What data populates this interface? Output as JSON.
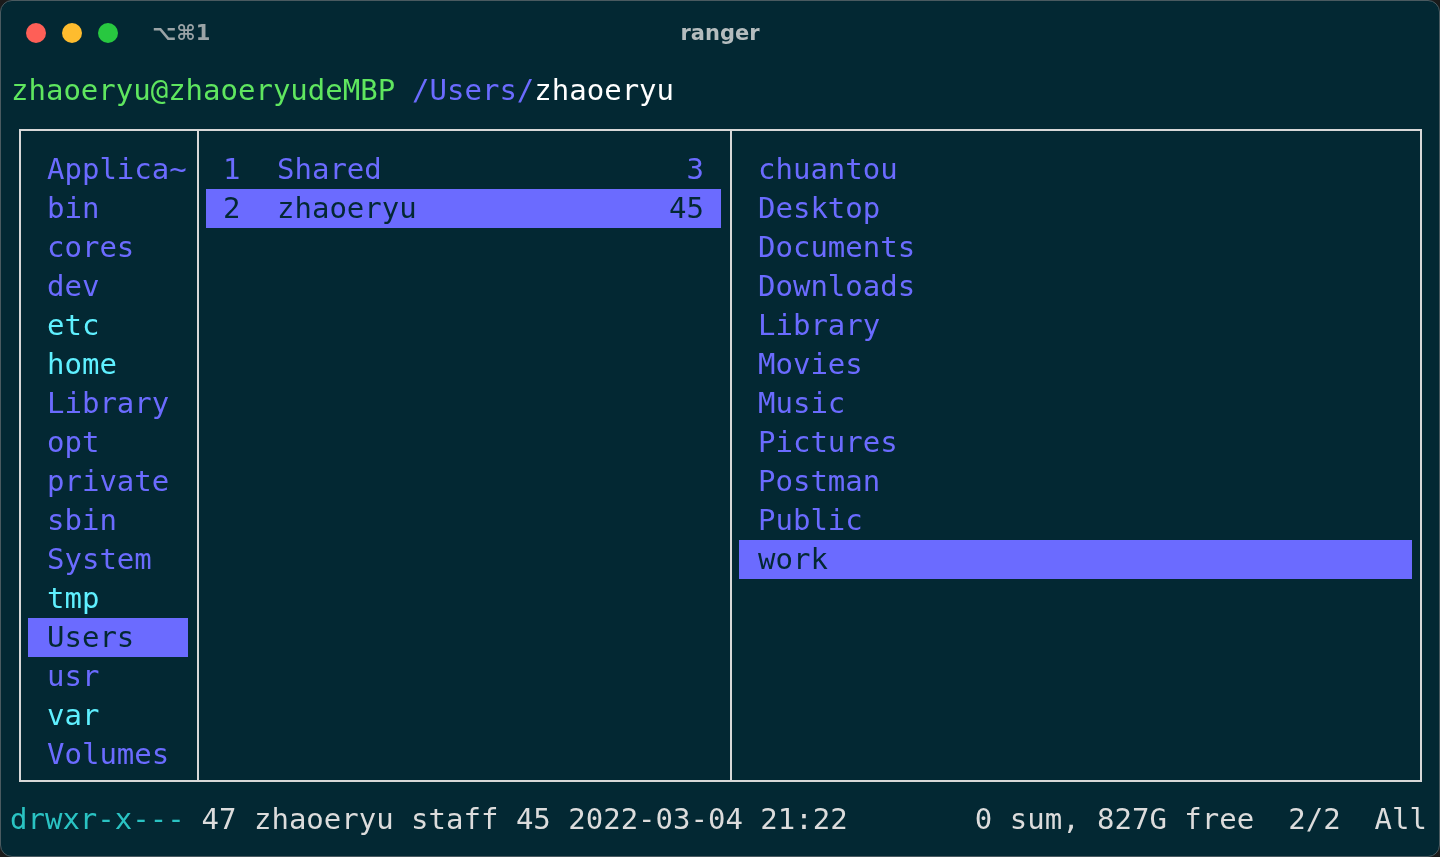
{
  "window": {
    "title": "ranger",
    "shortcut": "⌥⌘1"
  },
  "prompt": {
    "user_host": "zhaoeryu@zhaoeryudeMBP",
    "path_parent": "/Users/",
    "path_current": "zhaoeryu"
  },
  "parent_column": [
    {
      "name": "Applica~",
      "kind": "dir",
      "selected": false
    },
    {
      "name": "bin",
      "kind": "dir",
      "selected": false
    },
    {
      "name": "cores",
      "kind": "dir",
      "selected": false
    },
    {
      "name": "dev",
      "kind": "dir",
      "selected": false
    },
    {
      "name": "etc",
      "kind": "link",
      "selected": false
    },
    {
      "name": "home",
      "kind": "link",
      "selected": false
    },
    {
      "name": "Library",
      "kind": "dir",
      "selected": false
    },
    {
      "name": "opt",
      "kind": "dir",
      "selected": false
    },
    {
      "name": "private",
      "kind": "dir",
      "selected": false
    },
    {
      "name": "sbin",
      "kind": "dir",
      "selected": false
    },
    {
      "name": "System",
      "kind": "dir",
      "selected": false
    },
    {
      "name": "tmp",
      "kind": "link",
      "selected": false
    },
    {
      "name": "Users",
      "kind": "dir",
      "selected": true
    },
    {
      "name": "usr",
      "kind": "dir",
      "selected": false
    },
    {
      "name": "var",
      "kind": "link",
      "selected": false
    },
    {
      "name": "Volumes",
      "kind": "dir",
      "selected": false
    }
  ],
  "current_column": [
    {
      "index": "1",
      "name": "Shared",
      "size": "3",
      "selected": false
    },
    {
      "index": "2",
      "name": "zhaoeryu",
      "size": "45",
      "selected": true
    }
  ],
  "preview_column": [
    {
      "name": "chuantou",
      "selected": false
    },
    {
      "name": "Desktop",
      "selected": false
    },
    {
      "name": "Documents",
      "selected": false
    },
    {
      "name": "Downloads",
      "selected": false
    },
    {
      "name": "Library",
      "selected": false
    },
    {
      "name": "Movies",
      "selected": false
    },
    {
      "name": "Music",
      "selected": false
    },
    {
      "name": "Pictures",
      "selected": false
    },
    {
      "name": "Postman",
      "selected": false
    },
    {
      "name": "Public",
      "selected": false
    },
    {
      "name": "work",
      "selected": true
    }
  ],
  "status_bar": {
    "permissions": "drwxr-x---",
    "info": "47 zhaoeryu staff 45 2022-03-04 21:22",
    "disk": "0 sum, 827G free",
    "position": "2/2",
    "scroll": "All"
  }
}
